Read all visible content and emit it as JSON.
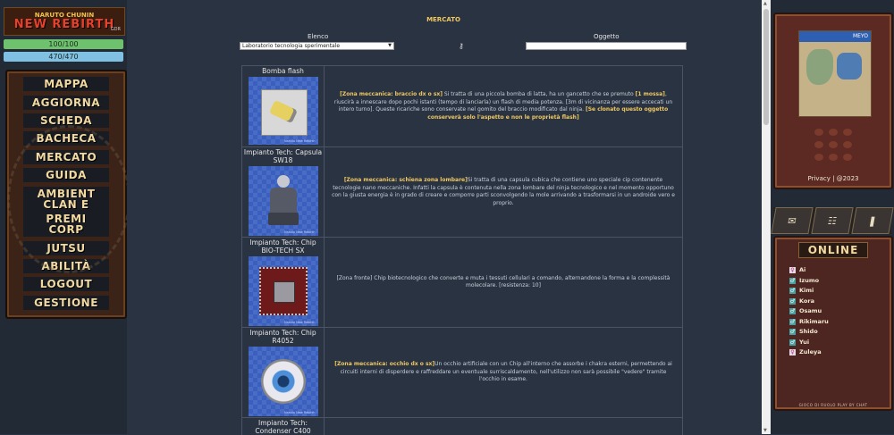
{
  "logo": {
    "line1": "NARUTO  CHUNIN",
    "line2": "NEW REBIRTH",
    "tag": "GDR"
  },
  "stats": {
    "hp": "100/100",
    "chakra": "470/470"
  },
  "menu": [
    "MAPPA",
    "AGGIORNA",
    "SCHEDA",
    "BACHECA",
    "MERCATO",
    "GUIDA",
    "AMBIENT",
    "CLAN E PREMI",
    "CORP",
    "JUTSU",
    "ABILITÀ",
    "LOGOUT",
    "GESTIONE"
  ],
  "market": {
    "title": "MERCATO",
    "list_label": "Elenco",
    "object_label": "Oggetto",
    "selected": "Laboratorio tecnologia sperimentale",
    "watermark": "Naruto New Rebirth"
  },
  "items": [
    {
      "name": "Bomba flash",
      "zone": "[Zona meccanica: braccio dx o sx]",
      "desc": " Si tratta di una piccola bomba di latta, ha un gancetto che se premuto ",
      "b2": "[1 mossa]",
      "desc2": ", riuscirà a innescare dopo pochi istanti (tempo di lanciarla) un flash di media potenza. [3m di vicinanza per essere accecati un intero turno]. Queste ricariche sono conservate nel gomito del braccio modificato dal ninja. ",
      "b3": "[Se clonato questo oggetto conserverà solo l'aspetto e non le proprietà flash]"
    },
    {
      "name": "Impianto Tech: Capsula SW18",
      "zone": "[Zona meccanica: schiena zona lombare]",
      "desc": "Si tratta di una capsula cubica che contiene uno speciale cip contenente tecnologie nano meccaniche. Infatti la capsula è contenuta nella zona lombare del ninja tecnologico e nel momento opportuno con la giusta energia è in grado di creare e comporre parti sconvolgendo la mole arrivando a trasformarsi in un androide vero e proprio.",
      "b2": "",
      "desc2": "",
      "b3": ""
    },
    {
      "name": "Impianto Tech: Chip BIO-TECH SX",
      "zone": "",
      "desc": "[Zona fronte] Chip biotecnologico che converte e muta i tessuti cellulari a comando, alternandone la forma e la complessità molecolare. [resistenza: 10]",
      "b2": "",
      "desc2": "",
      "b3": ""
    },
    {
      "name": "Impianto Tech: Chip R4052",
      "zone": "[Zona meccanica: occhio dx o sx]",
      "desc": "Un occhio artificiale con un Chip all'interno che assorbe i chakra esterni, permettendo ai circuiti interni di disperdere e raffreddare un eventuale surriscaldamento, nell'utilizzo non sarà possibile \"vedere\" tramite l'occhio in esame.",
      "b2": "",
      "desc2": "",
      "b3": ""
    },
    {
      "name": "Impianto Tech: Condenser C400",
      "zone": "",
      "desc": "",
      "b2": "",
      "desc2": "",
      "b3": ""
    }
  ],
  "right": {
    "privacy": "Privacy | @2023",
    "online_title": "ONLINE",
    "users": [
      "Ai",
      "Izumo",
      "Kimi",
      "Kora",
      "Osamu",
      "Rikimaru",
      "Shido",
      "Yui",
      "Zuleya"
    ],
    "footer": "GIOCO DI RUOLO PLAY BY CHAT",
    "map_banner": "MEYO"
  }
}
